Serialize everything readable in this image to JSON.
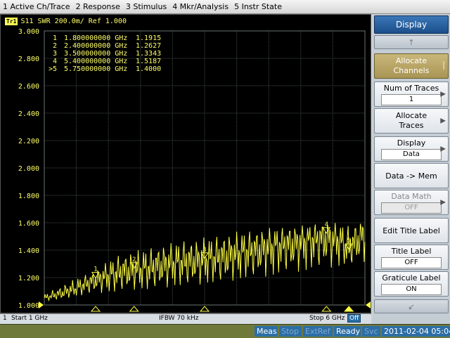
{
  "menu": {
    "items": [
      "1 Active Ch/Trace",
      "2 Response",
      "3 Stimulus",
      "4 Mkr/Analysis",
      "5 Instr State"
    ]
  },
  "trace": {
    "badge": "Tr1",
    "title": "S11  SWR 200.0m/ Ref 1.000",
    "y_ticks": [
      "3.000",
      "2.800",
      "2.600",
      "2.400",
      "2.200",
      "2.000",
      "1.800",
      "1.600",
      "1.400",
      "1.200",
      "1.000"
    ],
    "markers": [
      {
        "id": "1",
        "freq": "1.800000000 GHz",
        "value": "1.1915",
        "active": false
      },
      {
        "id": "2",
        "freq": "2.400000000 GHz",
        "value": "1.2627",
        "active": false
      },
      {
        "id": "3",
        "freq": "3.500000000 GHz",
        "value": "1.3343",
        "active": false
      },
      {
        "id": "4",
        "freq": "5.400000000 GHz",
        "value": "1.5187",
        "active": false
      },
      {
        "id": ">5",
        "freq": "5.750000000 GHz",
        "value": "1.4000",
        "active": true
      }
    ],
    "colors": {
      "trace": "#ffff44",
      "grid": "#3f4b46",
      "text": "#ffff66",
      "background": "#000000"
    }
  },
  "chart_data": {
    "type": "line",
    "xlim": [
      1,
      6
    ],
    "ylim": [
      1.0,
      3.0
    ],
    "xunit": "GHz",
    "grid": true,
    "series": [
      {
        "x": [
          1.0,
          1.25,
          1.5,
          1.8,
          2.0,
          2.2,
          2.4,
          2.6,
          2.8,
          3.0,
          3.2,
          3.5,
          3.8,
          4.0,
          4.2,
          4.4,
          4.6,
          4.8,
          5.0,
          5.2,
          5.4,
          5.6,
          5.75,
          6.0
        ],
        "y": [
          1.05,
          1.08,
          1.12,
          1.19,
          1.22,
          1.24,
          1.26,
          1.27,
          1.29,
          1.31,
          1.32,
          1.33,
          1.36,
          1.38,
          1.4,
          1.42,
          1.44,
          1.46,
          1.47,
          1.49,
          1.52,
          1.48,
          1.4,
          1.55
        ],
        "ripple_peak": [
          1.08,
          1.14,
          1.2,
          1.25,
          1.33,
          1.38,
          1.4,
          1.42,
          1.44,
          1.46,
          1.48,
          1.5,
          1.52,
          1.54,
          1.55,
          1.56,
          1.57,
          1.58,
          1.58,
          1.6,
          1.6,
          1.6,
          1.6,
          1.62
        ],
        "ripple_trough": [
          1.03,
          1.04,
          1.06,
          1.08,
          1.08,
          1.09,
          1.1,
          1.1,
          1.11,
          1.12,
          1.13,
          1.14,
          1.15,
          1.17,
          1.18,
          1.19,
          1.2,
          1.22,
          1.23,
          1.24,
          1.25,
          1.27,
          1.28,
          1.3
        ]
      }
    ]
  },
  "channel": {
    "num": "1",
    "start": "Start 1 GHz",
    "ifbw": "IFBW 70 kHz",
    "stop": "Stop 6 GHz",
    "off": "Off"
  },
  "softkeys": {
    "title": "Display",
    "allocate_channels": "Allocate\nChannels",
    "num_traces": {
      "label": "Num of Traces",
      "value": "1"
    },
    "allocate_traces": "Allocate\nTraces",
    "display": {
      "label": "Display",
      "value": "Data"
    },
    "data_mem": "Data -> Mem",
    "data_math": {
      "label": "Data Math",
      "value": "OFF"
    },
    "edit_title": "Edit Title Label",
    "title_label": {
      "label": "Title Label",
      "value": "OFF"
    },
    "graticule_label": {
      "label": "Graticule Label",
      "value": "ON"
    }
  },
  "status": {
    "meas": "Meas",
    "stop": "Stop",
    "extref": "ExtRef",
    "ready": "Ready",
    "svc": "Svc",
    "time": "2011-02-04 05:04"
  }
}
